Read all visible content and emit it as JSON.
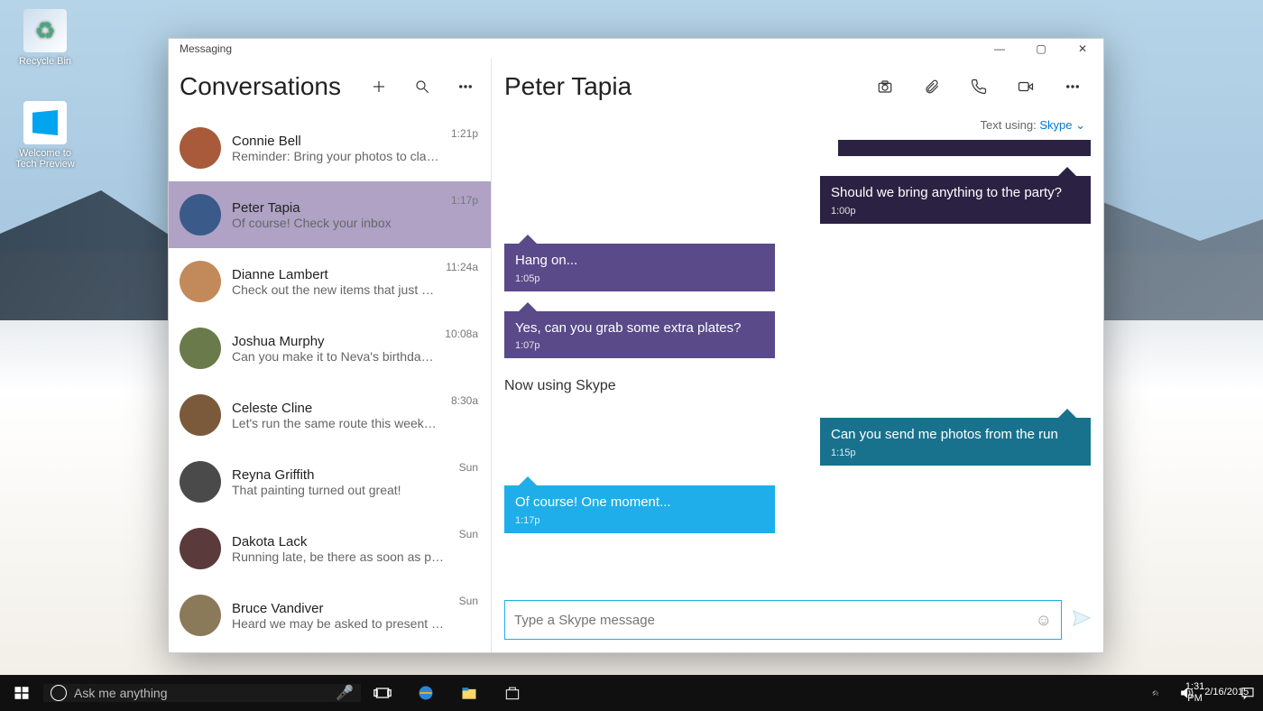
{
  "desktop": {
    "recycle_label": "Recycle Bin",
    "techprev_label": "Welcome to\nTech Preview"
  },
  "window": {
    "title": "Messaging"
  },
  "conversations": {
    "heading": "Conversations",
    "items": [
      {
        "name": "Connie Bell",
        "preview": "Reminder: Bring your photos to class on Thu",
        "time": "1:21p",
        "color": "#a85a3a"
      },
      {
        "name": "Peter Tapia",
        "preview": "Of course! Check your inbox",
        "time": "1:17p",
        "color": "#3a5a8a",
        "selected": true
      },
      {
        "name": "Dianne Lambert",
        "preview": "Check out the new items that just arrived",
        "time": "11:24a",
        "color": "#c28a5a"
      },
      {
        "name": "Joshua Murphy",
        "preview": "Can you make it to Neva's birthday party?",
        "time": "10:08a",
        "color": "#6a7a4a"
      },
      {
        "name": "Celeste Cline",
        "preview": "Let's run the same route this weekend",
        "time": "8:30a",
        "color": "#7a5a3a"
      },
      {
        "name": "Reyna Griffith",
        "preview": "That painting turned out great!",
        "time": "Sun",
        "color": "#4a4a4a"
      },
      {
        "name": "Dakota Lack",
        "preview": "Running late, be there as soon as possible",
        "time": "Sun",
        "color": "#5a3a3a"
      },
      {
        "name": "Bruce Vandiver",
        "preview": "Heard we may be asked to present at the sp",
        "time": "Sun",
        "color": "#8a7a5a"
      }
    ]
  },
  "chat": {
    "contact_name": "Peter Tapia",
    "text_using_label": "Text using:",
    "text_using_value": "Skype",
    "status_line": "Now using Skype",
    "compose_placeholder": "Type a Skype message",
    "messages": [
      {
        "side": "right",
        "color": "darkpurple",
        "text": "Should we bring anything to the party?",
        "time": "1:00p"
      },
      {
        "side": "left",
        "color": "purple",
        "text": "Hang on...",
        "time": "1:05p"
      },
      {
        "side": "left",
        "color": "purple",
        "text": "Yes, can you grab some extra plates?",
        "time": "1:07p"
      },
      {
        "side": "right",
        "color": "teal",
        "text": "Can you send me photos from the run",
        "time": "1:15p"
      },
      {
        "side": "left",
        "color": "blue",
        "text": "Of course!  One moment...",
        "time": "1:17p"
      }
    ]
  },
  "taskbar": {
    "search_placeholder": "Ask me anything",
    "time": "1:31 PM",
    "date": "2/16/2015"
  }
}
